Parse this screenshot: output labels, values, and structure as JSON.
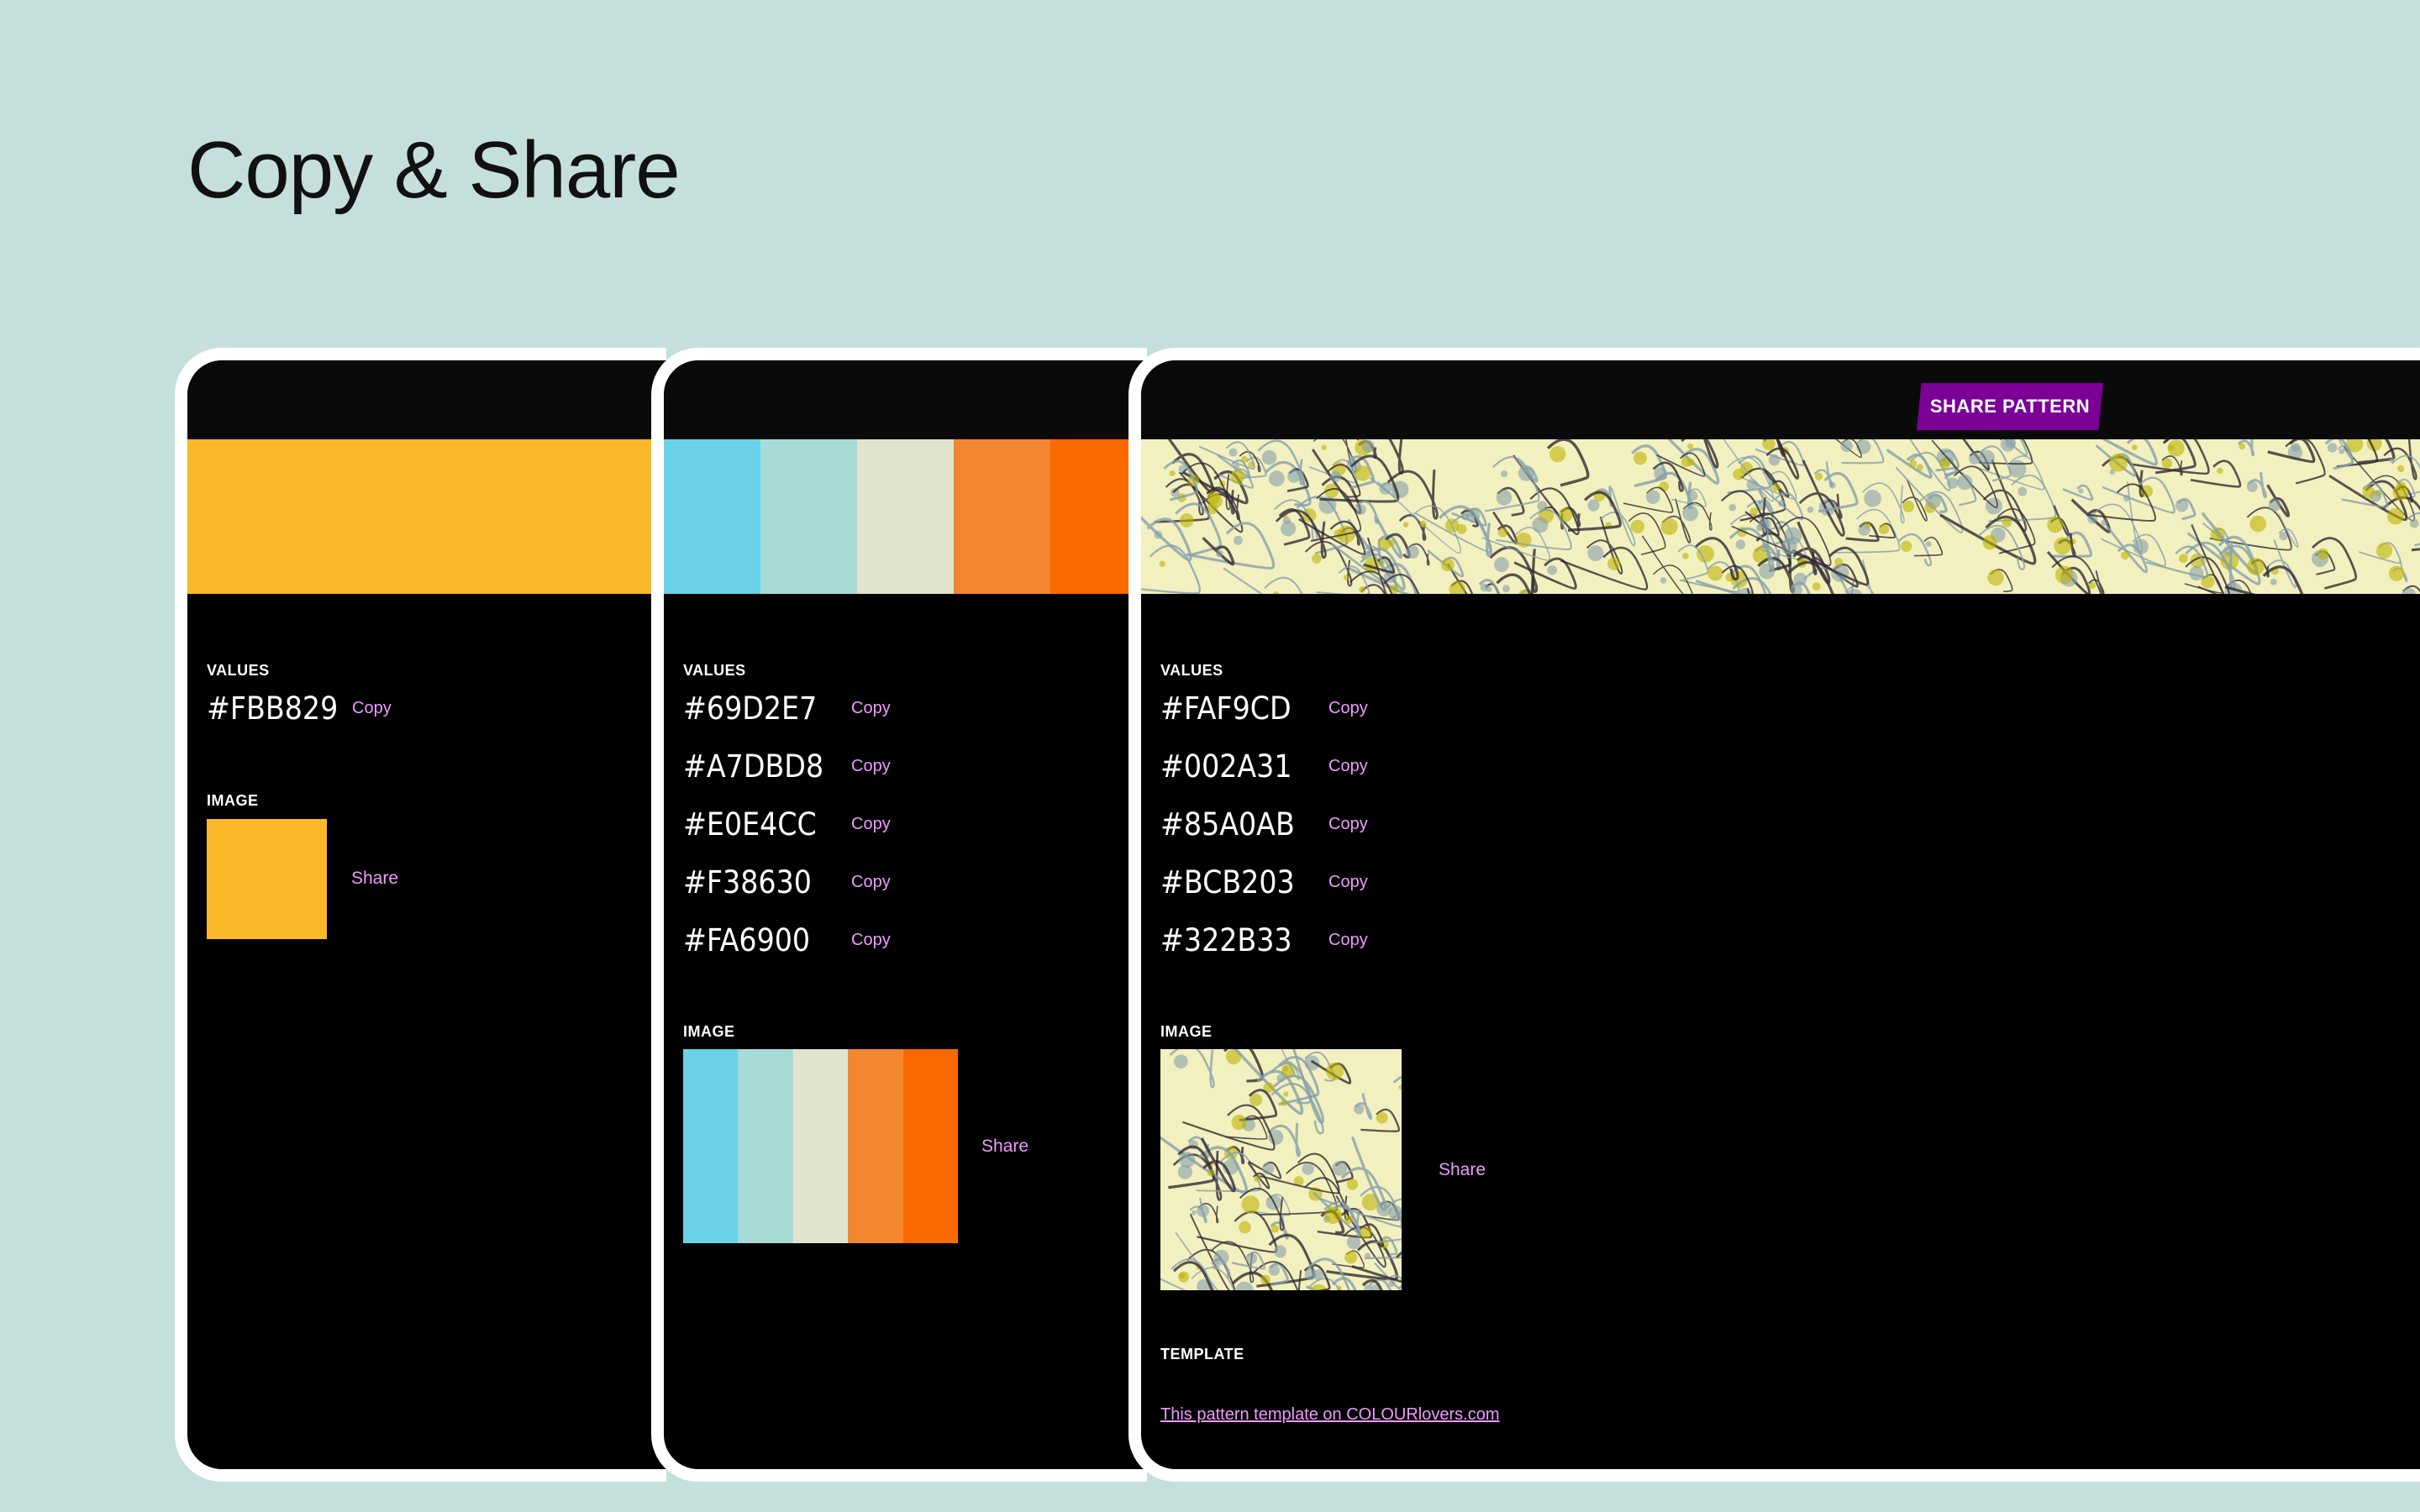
{
  "page": {
    "title": "Copy & Share",
    "background": "#c5e0dc"
  },
  "labels": {
    "values": "VALUES",
    "image": "IMAGE",
    "template": "TEMPLATE",
    "copy": "Copy",
    "share": "Share"
  },
  "accent": {
    "link_color": "#ee9bff",
    "button_color": "#7b0096"
  },
  "panels": [
    {
      "kind": "color",
      "colors": [
        "#FBB829"
      ]
    },
    {
      "kind": "palette",
      "colors": [
        "#69D2E7",
        "#A7DBD8",
        "#E0E4CC",
        "#F38630",
        "#FA6900"
      ]
    },
    {
      "kind": "pattern",
      "share_button": "SHARE PATTERN",
      "colors": [
        "#FAF9CD",
        "#002A31",
        "#85A0AB",
        "#BCB203",
        "#322B33"
      ],
      "template_link": "This pattern template on COLOURlovers.com"
    }
  ]
}
